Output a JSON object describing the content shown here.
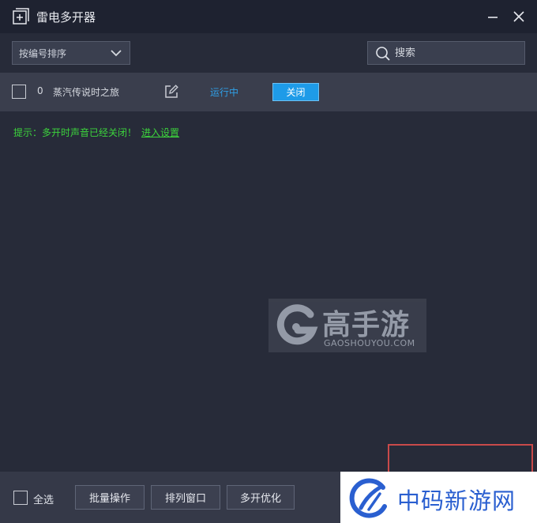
{
  "window": {
    "title": "雷电多开器"
  },
  "toolbar": {
    "sort_label": "按编号排序",
    "search_placeholder": "搜索"
  },
  "instances": [
    {
      "index": "0",
      "name": "蒸汽传说时之旅",
      "status": "运行中",
      "action_label": "关闭"
    }
  ],
  "tip": {
    "text": "提示：多开时声音已经关闭！",
    "link": "进入设置"
  },
  "watermarks": {
    "gaoshouyou_title": "高手游",
    "gaoshouyou_sub": "GAOSHOUYOU.COM",
    "zhongma": "中码新游网"
  },
  "bottombar": {
    "select_all_label": "全选",
    "batch_label": "批量操作",
    "arrange_label": "排列窗口",
    "optimize_label": "多开优化"
  },
  "colors": {
    "title_bg": "#1e2230",
    "body_bg": "#272b39",
    "row_bg": "#3a3e4d",
    "accent_blue": "#1e9be8",
    "status_blue": "#2f9fe6",
    "tip_green": "#3cd33c"
  },
  "icons": {
    "app": "add-window-icon",
    "minimize": "minimize-icon",
    "close": "close-icon",
    "dropdown": "chevron-down-icon",
    "search": "search-icon",
    "edit": "edit-icon"
  }
}
